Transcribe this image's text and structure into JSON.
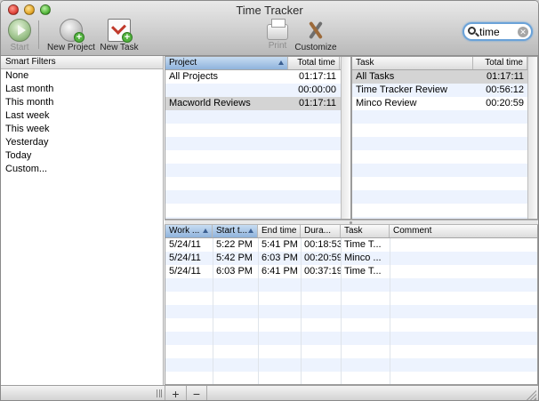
{
  "window": {
    "title": "Time Tracker"
  },
  "toolbar": {
    "start_label": "Start",
    "new_project_label": "New Project",
    "new_task_label": "New Task",
    "print_label": "Print",
    "customize_label": "Customize"
  },
  "search": {
    "value": "time"
  },
  "sidebar": {
    "header": "Smart Filters",
    "items": [
      "None",
      "Last month",
      "This month",
      "Last week",
      "This week",
      "Yesterday",
      "Today",
      "Custom..."
    ]
  },
  "projects": {
    "columns": [
      "Project",
      "Total time"
    ],
    "rows": [
      {
        "name": "All Projects",
        "total": "01:17:11"
      },
      {
        "name": "",
        "total": "00:00:00"
      },
      {
        "name": "Macworld Reviews",
        "total": "01:17:11"
      }
    ]
  },
  "tasks": {
    "columns": [
      "Task",
      "Total time"
    ],
    "rows": [
      {
        "name": "All Tasks",
        "total": "01:17:11"
      },
      {
        "name": "Time Tracker Review",
        "total": "00:56:12"
      },
      {
        "name": "Minco Review",
        "total": "00:20:59"
      }
    ]
  },
  "entries": {
    "columns": [
      "Work ...",
      "Start t...",
      "End time",
      "Dura...",
      "Task",
      "Comment"
    ],
    "rows": [
      {
        "date": "5/24/11",
        "start": "5:22 PM",
        "end": "5:41 PM",
        "duration": "00:18:53",
        "task": "Time T...",
        "comment": ""
      },
      {
        "date": "5/24/11",
        "start": "5:42 PM",
        "end": "6:03 PM",
        "duration": "00:20:59",
        "task": "Minco ...",
        "comment": ""
      },
      {
        "date": "5/24/11",
        "start": "6:03 PM",
        "end": "6:41 PM",
        "duration": "00:37:19",
        "task": "Time T...",
        "comment": ""
      }
    ]
  },
  "bottombar": {
    "add_label": "+",
    "remove_label": "−"
  }
}
